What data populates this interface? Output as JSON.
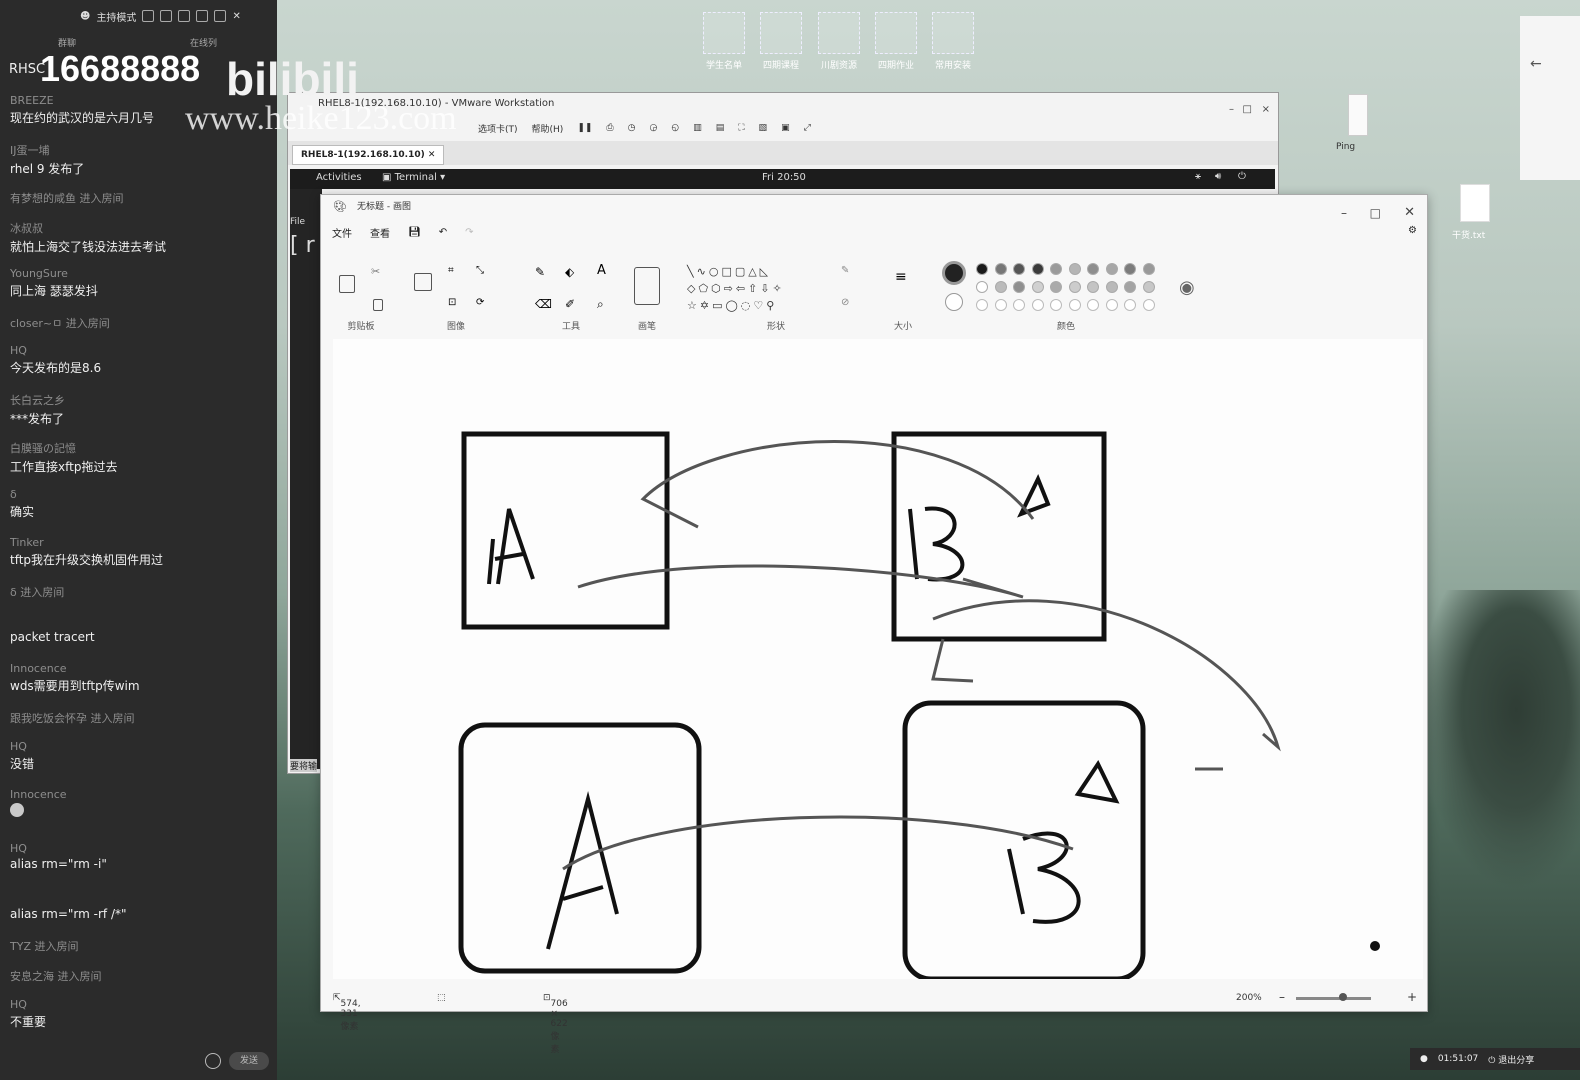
{
  "chat": {
    "header_mode": "主持模式",
    "tab_left": "群聊",
    "tab_right": "在线列",
    "watermark_number": "16688888",
    "watermark_brand": "bilibili",
    "watermark_site": "www.heike123.com",
    "rhs_label": "RHSC",
    "messages": [
      {
        "name": "BREEZE",
        "text": "现在约的武汉的是六月几号"
      },
      {
        "name": "IJ蛋一埔",
        "text": "rhel 9 发布了"
      },
      {
        "system": "有梦想的咸鱼 进入房间"
      },
      {
        "name": "冰叔叔",
        "text": "就怕上海交了钱没法进去考试"
      },
      {
        "name": "YoungSure",
        "text": "同上海  瑟瑟发抖"
      },
      {
        "system": "closer~ㅁ      进入房间"
      },
      {
        "name": "HQ",
        "text": "今天发布的是8.6"
      },
      {
        "name": "长白云之乡",
        "text": "***发布了"
      },
      {
        "name": "白膜骚の記憶",
        "text": "工作直接xftp拖过去"
      },
      {
        "name": "δ",
        "text": "确实"
      },
      {
        "name": "Tinker",
        "text": "tftp我在升级交换机固件用过"
      },
      {
        "system": "δ 进入房间"
      },
      {
        "name": "",
        "text": "packet tracert"
      },
      {
        "name": "Innocence",
        "text": "wds需要用到tftp传wim"
      },
      {
        "system": "跟我吃饭会怀孕 进入房间"
      },
      {
        "name": "HQ",
        "text": "没错"
      },
      {
        "name": "Innocence",
        "text": ""
      },
      {
        "name": "HQ",
        "text": "alias rm=\"rm -i\""
      },
      {
        "name": "",
        "text": "alias rm=\"rm -rf /*\""
      },
      {
        "system": "TYZ 进入房间"
      },
      {
        "system": "安息之海 进入房间"
      },
      {
        "name": "HQ",
        "text": "不重要"
      }
    ],
    "send_label": "发送"
  },
  "desktop": {
    "icons": [
      "学生名单",
      "四期课程",
      "川剧资源",
      "四期作业",
      "常用安装"
    ],
    "ping_label": "Ping",
    "file_label": "干货.txt"
  },
  "vmware": {
    "title": "RHEL8-1(192.168.10.10) - VMware Workstation",
    "menus": [
      "选项卡(T)",
      "帮助(H)"
    ],
    "tab_label": "RHEL8-1(192.168.10.10)",
    "gnome_activities": "Activities",
    "gnome_terminal": "Terminal",
    "gnome_clock": "Fri 20:50",
    "term_file": "File",
    "term_prompt": "[ r",
    "term_hint": "要将输"
  },
  "paint": {
    "title": "无标题 - 画图",
    "menu_file": "文件",
    "menu_view": "查看",
    "groups": {
      "clipboard": "剪贴板",
      "image": "图像",
      "tools": "工具",
      "brush": "画笔",
      "shapes": "形状",
      "size": "大小",
      "colors": "颜色"
    },
    "status_cursor": "574, 331像素",
    "status_size": "706 × 622像素",
    "zoom": "200%",
    "colors_row1": [
      "#1a1a1a",
      "#777777",
      "#555555",
      "#3a3a3a",
      "#9a9a9a",
      "#b5b5b5",
      "#8e8e8e",
      "#a7a7a7",
      "#7c7c7c",
      "#999999"
    ],
    "colors_row2": [
      "#ffffff",
      "#bbbbbb",
      "#8f8f8f",
      "#d0d0d0",
      "#aaaaaa",
      "#cccccc",
      "#c4c4c4",
      "#b9b9b9",
      "#a3a3a3",
      "#c7c7c7"
    ],
    "canvas_letters": {
      "box1": "A",
      "box2": "B",
      "box3": "A",
      "box4": "B"
    }
  },
  "taskbar": {
    "timer": "01:51:07",
    "exit_share": "退出分享"
  }
}
